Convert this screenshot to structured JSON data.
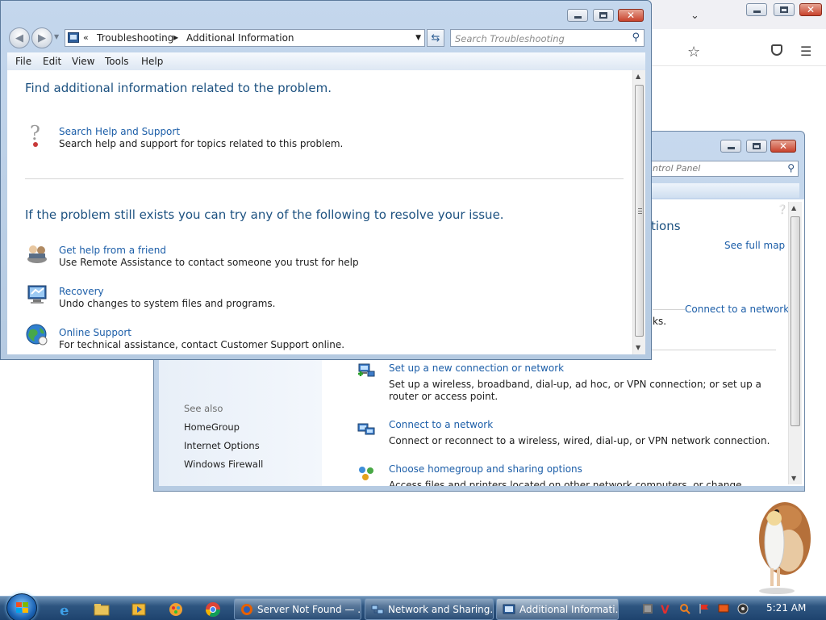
{
  "troubleshooting_window": {
    "title_buttons": {
      "minimize": "",
      "maximize": "",
      "close": "✕"
    },
    "nav": {
      "back": "◀",
      "forward": "▶"
    },
    "address": {
      "overflow": "«",
      "crumbs": [
        "Troubleshooting",
        "Additional Information"
      ]
    },
    "search_placeholder": "Search Troubleshooting",
    "menu": [
      "File",
      "Edit",
      "View",
      "Tools",
      "Help"
    ],
    "heading1": "Find additional information related to the problem.",
    "search_help": {
      "title": "Search Help and Support",
      "description": "Search help and support for topics related to this problem.",
      "icon": "help-question-icon"
    },
    "heading2": "If the problem still exists you can try any of the following to resolve your issue.",
    "options": [
      {
        "title": "Get help from a friend",
        "description": "Use Remote Assistance to contact someone you trust for help",
        "icon": "remote-assistance-icon"
      },
      {
        "title": "Recovery",
        "description": "Undo changes to system files and programs.",
        "icon": "recovery-icon"
      },
      {
        "title": "Online Support",
        "description": "For technical assistance, contact Customer Support online.",
        "icon": "globe-icon"
      }
    ]
  },
  "network_window": {
    "search_partial": "ntrol Panel",
    "heading_partial": "tions",
    "see_full_map": "See full map",
    "connect_to_network_right": "Connect to a network",
    "partial_text": "ks.",
    "see_also": "See also",
    "see_also_links": [
      "HomeGroup",
      "Internet Options",
      "Windows Firewall"
    ],
    "items": [
      {
        "title": "Set up a new connection or network",
        "description": "Set up a wireless, broadband, dial-up, ad hoc, or VPN connection; or set up a router or access point.",
        "icon": "new-connection-icon"
      },
      {
        "title": "Connect to a network",
        "description": "Connect or reconnect to a wireless, wired, dial-up, or VPN network connection.",
        "icon": "network-connect-icon"
      },
      {
        "title": "Choose homegroup and sharing options",
        "description": "Access files and printers located on other network computers, or change sharing settings.",
        "icon": "homegroup-icon"
      }
    ]
  },
  "taskbar": {
    "tasks": [
      {
        "label": "Server Not Found — ...",
        "icon": "firefox-icon"
      },
      {
        "label": "Network and Sharing...",
        "icon": "network-center-icon"
      },
      {
        "label": "Additional Informati...",
        "icon": "troubleshooting-icon"
      }
    ],
    "clock": "5:21 AM"
  },
  "colors": {
    "link": "#1c5ea8",
    "heading": "#1c5180",
    "taskbar": "#2e5580"
  }
}
